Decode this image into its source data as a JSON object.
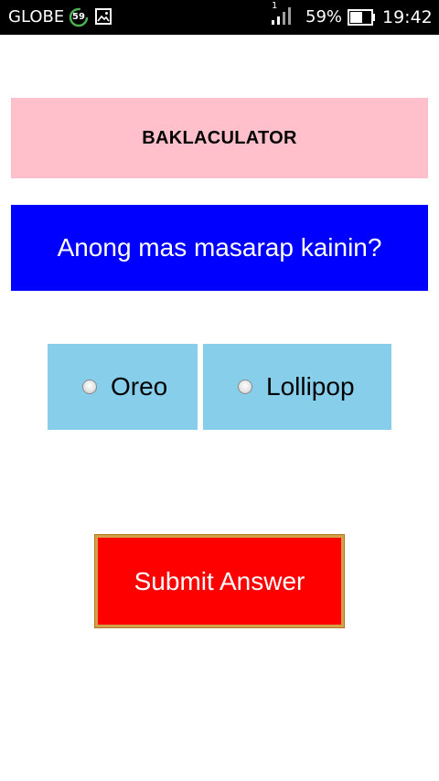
{
  "status_bar": {
    "carrier": "GLOBE",
    "data_badge": "59",
    "signal_sub": "1",
    "battery_percent": "59%",
    "time": "19:42",
    "icons": {
      "gallery": "image-icon",
      "signal": "signal-icon",
      "battery": "battery-icon"
    }
  },
  "app": {
    "title": "BAKLACULATOR",
    "question": "Anong mas masarap kainin?",
    "options": [
      {
        "label": "Oreo",
        "checked": false
      },
      {
        "label": "Lollipop",
        "checked": false
      }
    ],
    "submit_label": "Submit Answer"
  },
  "colors": {
    "title_bg": "#ffc0cb",
    "question_bg": "#0000ff",
    "option_bg": "#87ceeb",
    "submit_bg": "#ff0000",
    "submit_border": "#d4a14a"
  }
}
